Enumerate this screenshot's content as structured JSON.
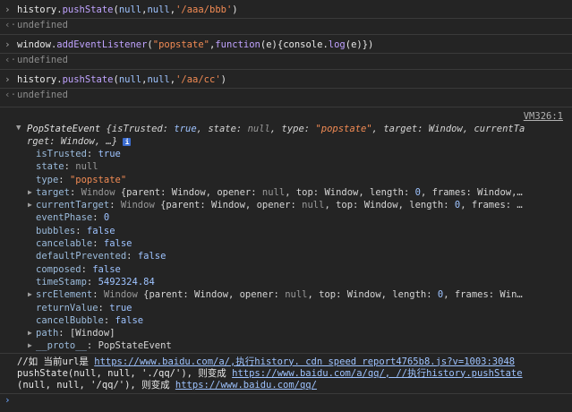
{
  "commands": [
    {
      "text": "history.pushState(null,null,'/aaa/bbb')",
      "result": "undefined"
    },
    {
      "text": "window.addEventListener(\"popstate\",function(e){console.log(e)})",
      "result": "undefined"
    },
    {
      "text": "history.pushState(null,null,'/aa/cc')",
      "result": "undefined"
    }
  ],
  "log": {
    "source": "VM326:1",
    "header_line1": "PopStateEvent {isTrusted: true, state: null, type: \"popstate\", target: Window, currentTa",
    "header_line2": "rget: Window, …}",
    "info_glyph": "i",
    "props": [
      {
        "k": "isTrusted",
        "v": "true",
        "t": "bool",
        "expand": false
      },
      {
        "k": "state",
        "v": "null",
        "t": "null",
        "expand": false
      },
      {
        "k": "type",
        "v": "\"popstate\"",
        "t": "str",
        "expand": false
      },
      {
        "k": "target",
        "v": "Window {parent: Window, opener: null, top: Window, length: 0, frames: Window,…",
        "t": "obj",
        "expand": true
      },
      {
        "k": "currentTarget",
        "v": "Window {parent: Window, opener: null, top: Window, length: 0, frames: …",
        "t": "obj",
        "expand": true
      },
      {
        "k": "eventPhase",
        "v": "0",
        "t": "num",
        "expand": false
      },
      {
        "k": "bubbles",
        "v": "false",
        "t": "bool",
        "expand": false
      },
      {
        "k": "cancelable",
        "v": "false",
        "t": "bool",
        "expand": false
      },
      {
        "k": "defaultPrevented",
        "v": "false",
        "t": "bool",
        "expand": false
      },
      {
        "k": "composed",
        "v": "false",
        "t": "bool",
        "expand": false
      },
      {
        "k": "timeStamp",
        "v": "5492324.84",
        "t": "num",
        "expand": false
      },
      {
        "k": "srcElement",
        "v": "Window {parent: Window, opener: null, top: Window, length: 0, frames: Win…",
        "t": "obj",
        "expand": true
      },
      {
        "k": "returnValue",
        "v": "true",
        "t": "bool",
        "expand": false
      },
      {
        "k": "cancelBubble",
        "v": "false",
        "t": "bool",
        "expand": false
      },
      {
        "k": "path",
        "v": "[Window]",
        "t": "obj",
        "expand": true
      },
      {
        "k": "__proto__",
        "v": "PopStateEvent",
        "t": "obj",
        "expand": true
      }
    ]
  },
  "note": {
    "line1_prefix": "//如 当前url是 ",
    "line1_link": "https://www.baidu.com/a/,执行history. cdn speed report4765b8.js?v=1003:3048",
    "line2_prefix": "pushState(null, null, './qq/'), 则变成 ",
    "line2_link": "https://www.baidu.com/a/qq/, //执行history.pushState",
    "line3_prefix": "(null, null, '/qq/'), 则变成 ",
    "line3_link": "https://www.baidu.com/qq/"
  },
  "prompt_glyph": "›",
  "return_glyph": "‹·",
  "colors": {
    "background": "#242424",
    "string": "#f28b54",
    "keyword": "#9ec3ff",
    "link": "#9ec3ff"
  }
}
